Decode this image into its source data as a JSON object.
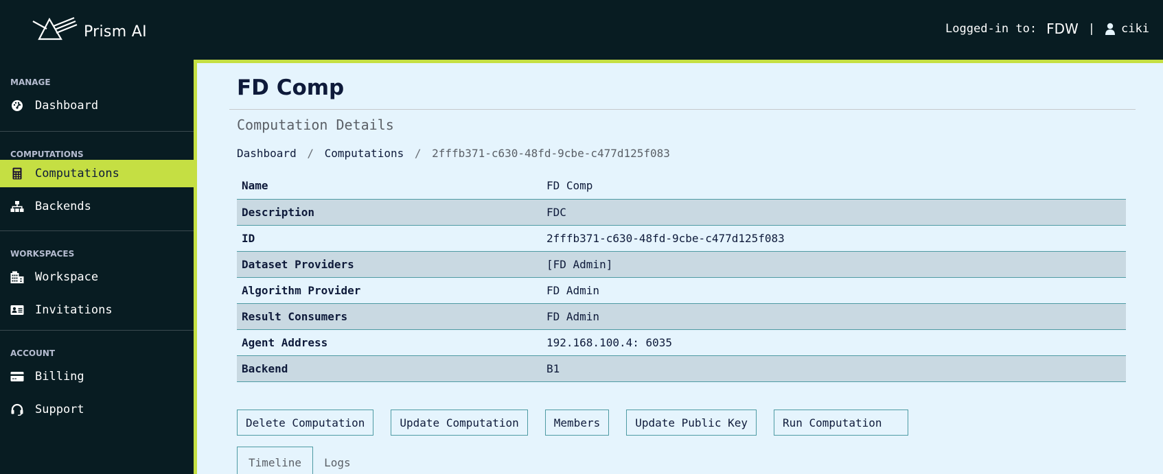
{
  "header": {
    "brand_name": "Prism AI",
    "logged_in_label": "Logged-in to:",
    "org": "FDW",
    "separator": "|",
    "username": "ciki",
    "user_icon": "user-icon",
    "logo_icon": "prism-logo-icon"
  },
  "sidebar": {
    "sections": [
      {
        "title": "MANAGE",
        "items": [
          {
            "label": "Dashboard",
            "icon": "dashboard-gauge-icon"
          }
        ]
      },
      {
        "title": "COMPUTATIONS",
        "items": [
          {
            "label": "Computations",
            "icon": "calculator-icon",
            "active": true
          },
          {
            "label": "Backends",
            "icon": "sitemap-icon"
          }
        ]
      },
      {
        "title": "WORKSPACES",
        "items": [
          {
            "label": "Workspace",
            "icon": "building-icon"
          },
          {
            "label": "Invitations",
            "icon": "id-card-icon"
          }
        ]
      },
      {
        "title": "ACCOUNT",
        "items": [
          {
            "label": "Billing",
            "icon": "credit-card-icon"
          },
          {
            "label": "Support",
            "icon": "headset-icon"
          }
        ]
      }
    ]
  },
  "main": {
    "title": "FD Comp",
    "subtitle": "Computation Details",
    "breadcrumb": {
      "items": [
        "Dashboard",
        "Computations"
      ],
      "current": "2fffb371-c630-48fd-9cbe-c477d125f083",
      "separator": "/"
    },
    "details": [
      {
        "key": "Name",
        "value": "FD Comp"
      },
      {
        "key": "Description",
        "value": "FDC"
      },
      {
        "key": "ID",
        "value": "2fffb371-c630-48fd-9cbe-c477d125f083"
      },
      {
        "key": "Dataset Providers",
        "value": "[FD Admin]"
      },
      {
        "key": "Algorithm Provider",
        "value": "FD Admin"
      },
      {
        "key": "Result Consumers",
        "value": "FD Admin"
      },
      {
        "key": "Agent Address",
        "value": "192.168.100.4: 6035"
      },
      {
        "key": "Backend",
        "value": "B1"
      }
    ],
    "actions": [
      "Delete Computation",
      "Update Computation",
      "Members",
      "Update Public Key",
      "Run Computation"
    ],
    "tabs": [
      {
        "label": "Timeline",
        "active": true
      },
      {
        "label": "Logs",
        "active": false
      }
    ]
  },
  "colors": {
    "accent": "#c5df43",
    "dark_bg": "#081c22",
    "content_bg": "#e5f4fd",
    "row_alt": "#c9d9e2",
    "border_teal": "#4d9aa3"
  }
}
